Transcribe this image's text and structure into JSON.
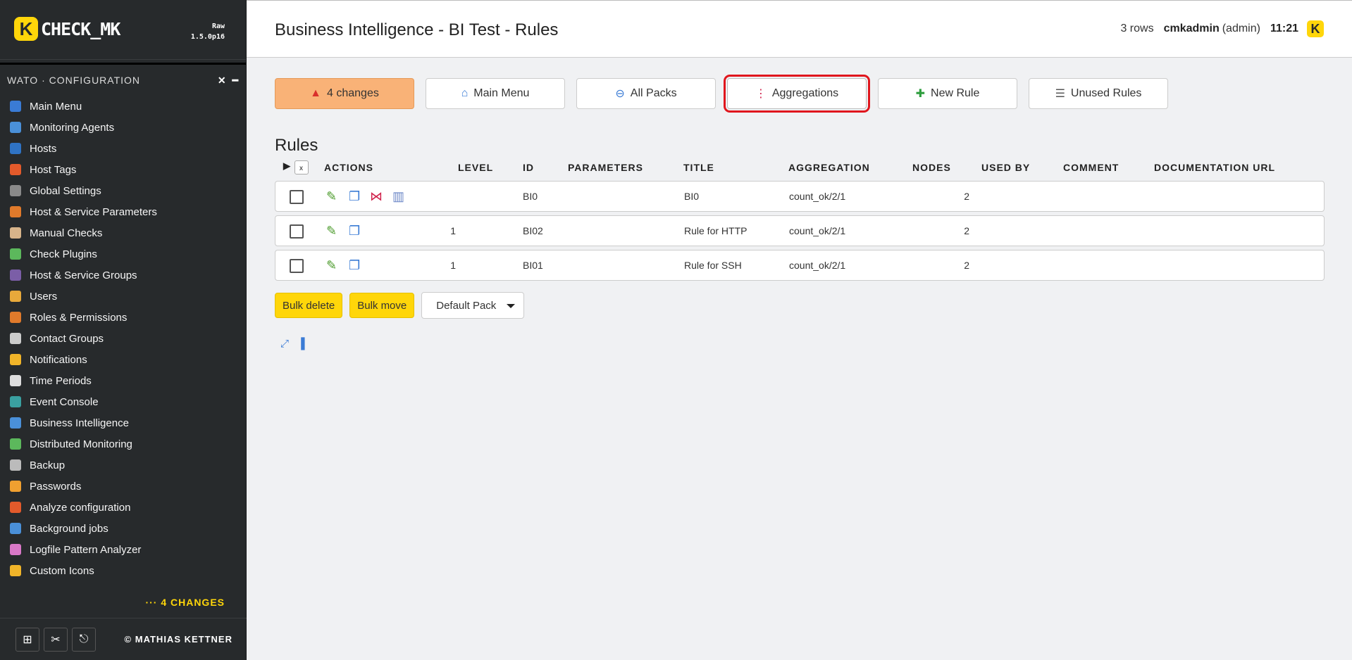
{
  "sidebar": {
    "logo_text": "CHECK_MK",
    "edition": "Raw",
    "version": "1.5.0p16",
    "snapin_title": "WATO · CONFIGURATION",
    "menu": [
      {
        "label": "Main Menu",
        "icon": "main-menu-icon",
        "color": "#3a7bd5"
      },
      {
        "label": "Monitoring Agents",
        "icon": "agents-icon",
        "color": "#4a90d9"
      },
      {
        "label": "Hosts",
        "icon": "hosts-icon",
        "color": "#2f73c4"
      },
      {
        "label": "Host Tags",
        "icon": "tags-icon",
        "color": "#e35a2b"
      },
      {
        "label": "Global Settings",
        "icon": "settings-icon",
        "color": "#8a8a8a"
      },
      {
        "label": "Host & Service Parameters",
        "icon": "parameters-icon",
        "color": "#e07a2b"
      },
      {
        "label": "Manual Checks",
        "icon": "manual-checks-icon",
        "color": "#d8b48a"
      },
      {
        "label": "Check Plugins",
        "icon": "plugins-icon",
        "color": "#5cb85c"
      },
      {
        "label": "Host & Service Groups",
        "icon": "groups-icon",
        "color": "#7b5ea7"
      },
      {
        "label": "Users",
        "icon": "users-icon",
        "color": "#e8a93b"
      },
      {
        "label": "Roles & Permissions",
        "icon": "roles-icon",
        "color": "#e07a2b"
      },
      {
        "label": "Contact Groups",
        "icon": "contact-groups-icon",
        "color": "#cccccc"
      },
      {
        "label": "Notifications",
        "icon": "notifications-icon",
        "color": "#f0b429"
      },
      {
        "label": "Time Periods",
        "icon": "time-periods-icon",
        "color": "#dddddd"
      },
      {
        "label": "Event Console",
        "icon": "event-console-icon",
        "color": "#3aa0a0"
      },
      {
        "label": "Business Intelligence",
        "icon": "bi-icon",
        "color": "#4a90d9"
      },
      {
        "label": "Distributed Monitoring",
        "icon": "distributed-icon",
        "color": "#5cb85c"
      },
      {
        "label": "Backup",
        "icon": "backup-icon",
        "color": "#bbbbbb"
      },
      {
        "label": "Passwords",
        "icon": "passwords-icon",
        "color": "#f0a030"
      },
      {
        "label": "Analyze configuration",
        "icon": "analyze-icon",
        "color": "#e35a2b"
      },
      {
        "label": "Background jobs",
        "icon": "background-jobs-icon",
        "color": "#4a90d9"
      },
      {
        "label": "Logfile Pattern Analyzer",
        "icon": "logfile-icon",
        "color": "#d978c7"
      },
      {
        "label": "Custom Icons",
        "icon": "custom-icons-icon",
        "color": "#f0b429"
      }
    ],
    "changes_link": "··· 4 CHANGES",
    "copyright": "© MATHIAS KETTNER"
  },
  "header": {
    "title": "Business Intelligence - BI Test - Rules",
    "rows": "3 rows",
    "user": "cmkadmin",
    "role": "(admin)",
    "time": "11:21"
  },
  "buttons": [
    {
      "label": "4 changes",
      "icon": "warning-icon"
    },
    {
      "label": "Main Menu",
      "icon": "main-menu-icon"
    },
    {
      "label": "All Packs",
      "icon": "back-icon"
    },
    {
      "label": "Aggregations",
      "icon": "aggregations-icon"
    },
    {
      "label": "New Rule",
      "icon": "new-icon"
    },
    {
      "label": "Unused Rules",
      "icon": "unused-rules-icon"
    }
  ],
  "rules": {
    "heading": "Rules",
    "columns": [
      "ACTIONS",
      "LEVEL",
      "ID",
      "PARAMETERS",
      "TITLE",
      "AGGREGATION",
      "NODES",
      "USED BY",
      "COMMENT",
      "DOCUMENTATION URL"
    ],
    "rows": [
      {
        "level": "",
        "id": "BI0",
        "parameters": "",
        "title": "BI0",
        "aggregation": "count_ok/2/1",
        "nodes": "2",
        "used_by": "",
        "comment": "",
        "doc_url": ""
      },
      {
        "level": "1",
        "id": "BI02",
        "parameters": "",
        "title": "Rule for HTTP",
        "aggregation": "count_ok/2/1",
        "nodes": "2",
        "used_by": "",
        "comment": "",
        "doc_url": ""
      },
      {
        "level": "1",
        "id": "BI01",
        "parameters": "",
        "title": "Rule for SSH",
        "aggregation": "count_ok/2/1",
        "nodes": "2",
        "used_by": "",
        "comment": "",
        "doc_url": ""
      }
    ]
  },
  "bulk": {
    "delete_label": "Bulk delete",
    "move_label": "Bulk move",
    "pack_selected": "Default Pack"
  }
}
